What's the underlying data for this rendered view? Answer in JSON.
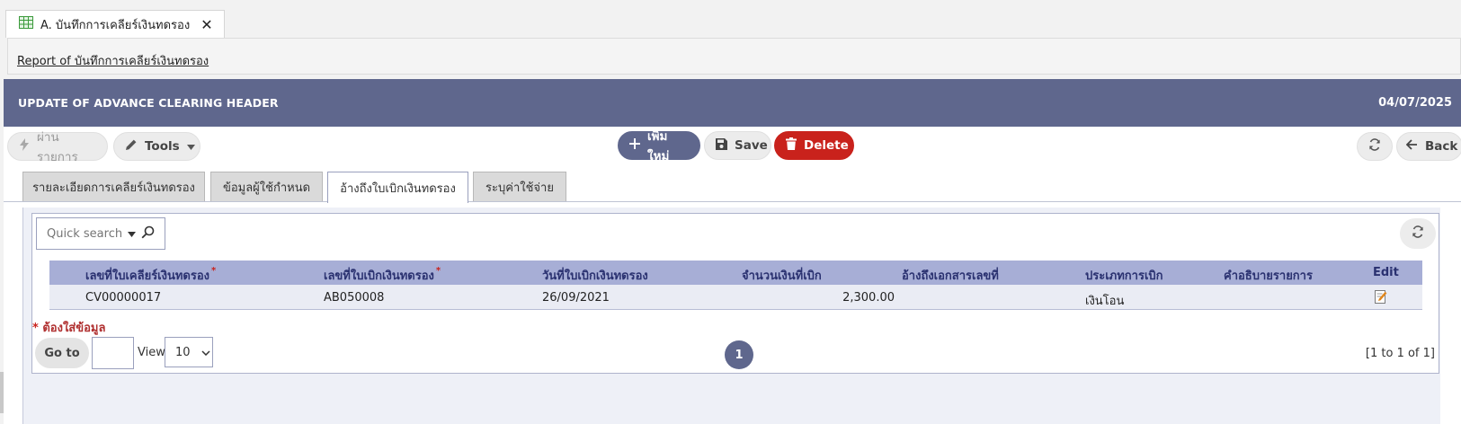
{
  "doc_tab": {
    "label": "A. บันทึกการเคลียร์เงินทดรอง",
    "close": "✕"
  },
  "report_link": "Report of บันทึกการเคลียร์เงินทดรอง",
  "header": {
    "title": "UPDATE OF ADVANCE CLEARING HEADER",
    "date": "04/07/2025"
  },
  "toolbar": {
    "post": "ผ่านรายการ",
    "tools": "Tools",
    "add": "เพิ่มใหม่",
    "save": "Save",
    "delete": "Delete",
    "back": "Back"
  },
  "subtabs": [
    {
      "label": "รายละเอียดการเคลียร์เงินทดรอง",
      "active": false
    },
    {
      "label": "ข้อมูลผู้ใช้กำหนด",
      "active": false
    },
    {
      "label": "อ้างถึงใบเบิกเงินทดรอง",
      "active": true
    },
    {
      "label": "ระบุค่าใช้จ่าย",
      "active": false
    }
  ],
  "grid": {
    "search_placeholder": "Quick search",
    "columns": [
      {
        "label": "เลขที่ใบเคลียร์เงินทดรอง",
        "required": true
      },
      {
        "label": "เลขที่ใบเบิกเงินทดรอง",
        "required": true
      },
      {
        "label": "วันที่ใบเบิกเงินทดรอง",
        "required": false
      },
      {
        "label": "จำนวนเงินที่เบิก",
        "required": false
      },
      {
        "label": "อ้างถึงเอกสารเลขที่",
        "required": false
      },
      {
        "label": "ประเภทการเบิก",
        "required": false
      },
      {
        "label": "คำอธิบายรายการ",
        "required": false
      },
      {
        "label": "Edit",
        "required": false
      }
    ],
    "rows": [
      [
        "CV00000017",
        "AB050008",
        "26/09/2021",
        "2,300.00",
        "",
        "เงินโอน",
        ""
      ]
    ],
    "required_note": "ต้องใส่ข้อมูล",
    "required_mark": "*"
  },
  "pager": {
    "goto": "Go to",
    "goto_value": "",
    "view_label": "View",
    "view_value": "10",
    "current_page": "1",
    "info": "[1 to 1 of 1]"
  },
  "colors": {
    "header": "#5f678d",
    "add_button": "#5f678d",
    "delete_button": "#c9221c",
    "table_header": "#a7aed6",
    "required": "#c9221c"
  },
  "icons": {
    "doc_tab": "spreadsheet-icon",
    "post": "lightning-icon",
    "tools": "pencil-icon",
    "add": "plus-icon",
    "save": "floppy-disk-icon",
    "delete": "trash-icon",
    "refresh": "refresh-icon",
    "back": "arrow-left-icon",
    "search": "search-icon",
    "edit": "edit-note-icon"
  }
}
